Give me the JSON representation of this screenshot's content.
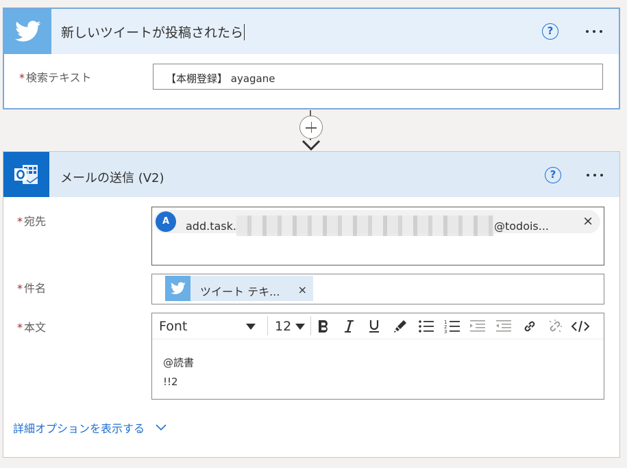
{
  "trigger": {
    "title": "新しいツイートが投稿されたら",
    "help_icon": "?",
    "search_label": "検索テキスト",
    "search_value": "【本棚登録】 ayagane"
  },
  "action": {
    "title": "メールの送信 (V2)",
    "help_icon": "?",
    "to_label": "宛先",
    "to_avatar": "A",
    "to_prefix": "add.task.",
    "to_suffix": "@todois...",
    "remove_glyph": "×",
    "subject_label": "件名",
    "subject_token": "ツイート テキ...",
    "body_label": "本文",
    "toolbar": {
      "font": "Font",
      "size": "12"
    },
    "body_lines": [
      "@読書",
      "!!2"
    ],
    "advanced_link": "詳細オプションを表示する"
  },
  "required_mark": "*",
  "colors": {
    "twitter_blue": "#6aafe6",
    "outlook_blue": "#0f6cc7",
    "link_blue": "#1f6fd0",
    "required_red": "#a4262c"
  }
}
